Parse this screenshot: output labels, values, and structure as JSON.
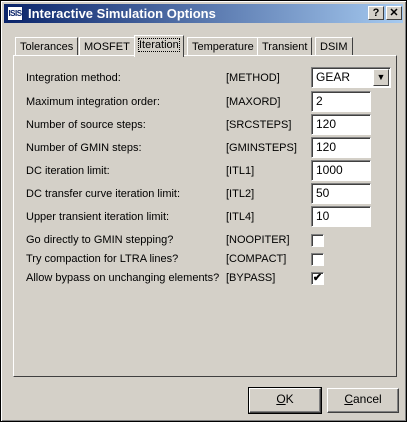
{
  "window": {
    "icon_text": "ISIS",
    "title": "Interactive Simulation Options",
    "help_button": "?",
    "close_button": "✕"
  },
  "tabs": [
    {
      "label": "Tolerances"
    },
    {
      "label": "MOSFET"
    },
    {
      "label": "Iteration"
    },
    {
      "label": "Temperature"
    },
    {
      "label": "Transient"
    },
    {
      "label": "DSIM"
    }
  ],
  "active_tab": "Iteration",
  "rows": [
    {
      "label": "Integration method:",
      "key": "[METHOD]",
      "value": "GEAR"
    },
    {
      "label": "Maximum integration order:",
      "key": "[MAXORD]",
      "value": "2"
    },
    {
      "label": "Number of source steps:",
      "key": "[SRCSTEPS]",
      "value": "120"
    },
    {
      "label": "Number of GMIN steps:",
      "key": "[GMINSTEPS]",
      "value": "120"
    },
    {
      "label": "DC iteration limit:",
      "key": "[ITL1]",
      "value": "1000"
    },
    {
      "label": "DC transfer curve iteration limit:",
      "key": "[ITL2]",
      "value": "50"
    },
    {
      "label": "Upper transient iteration limit:",
      "key": "[ITL4]",
      "value": "10"
    }
  ],
  "checks": [
    {
      "label": "Go directly to GMIN stepping?",
      "key": "[NOOPITER]",
      "checked": false,
      "mark": ""
    },
    {
      "label": "Try compaction for LTRA lines?",
      "key": "[COMPACT]",
      "checked": false,
      "mark": ""
    },
    {
      "label": "Allow bypass on unchanging elements?",
      "key": "[BYPASS]",
      "checked": true,
      "mark": "✔"
    }
  ],
  "buttons": {
    "ok_mnemonic": "O",
    "ok_rest": "K",
    "cancel_mnemonic": "C",
    "cancel_rest": "ancel"
  }
}
